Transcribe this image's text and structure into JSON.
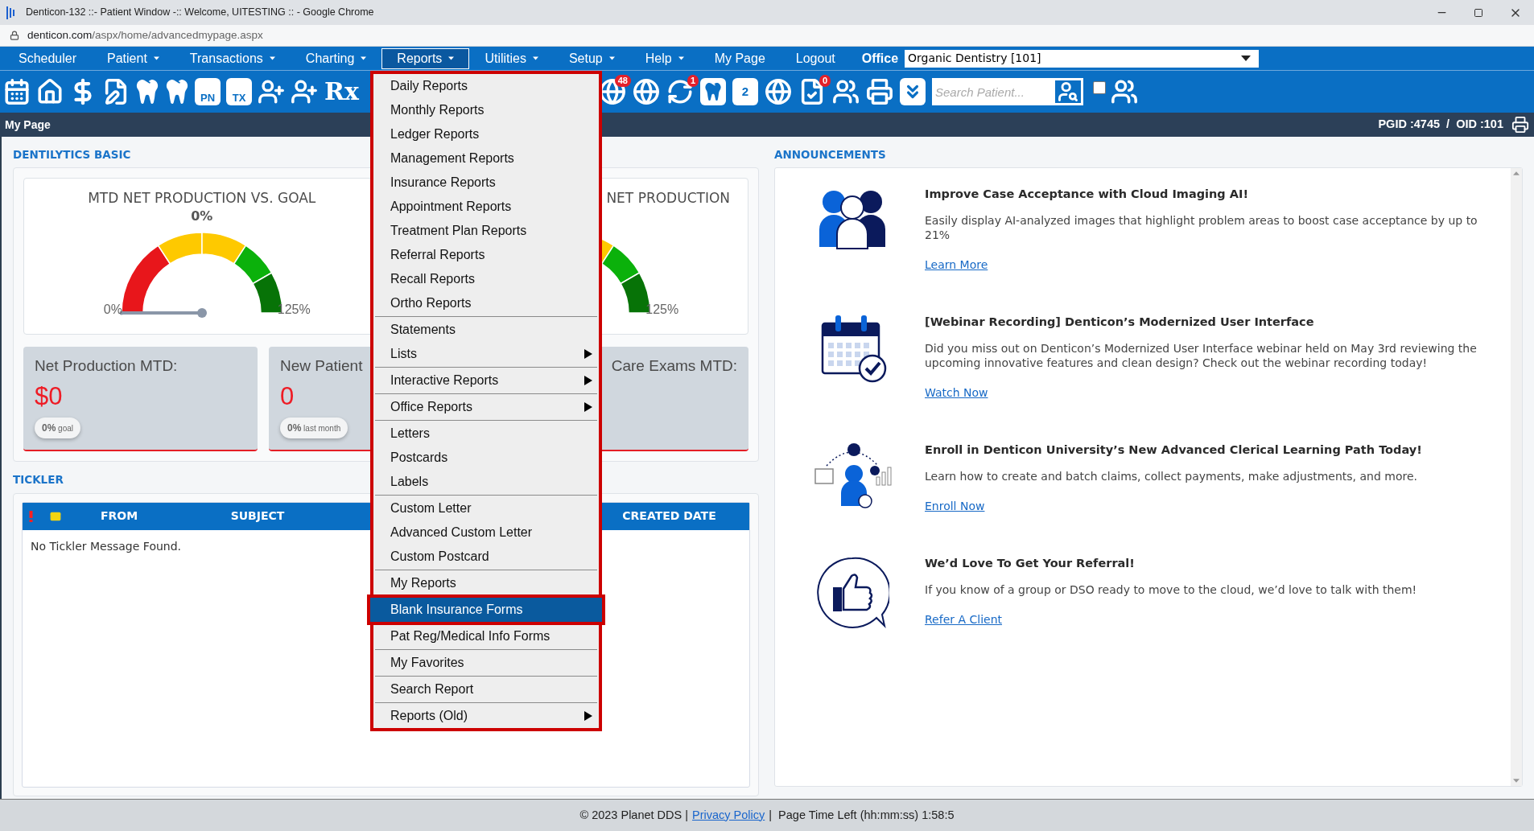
{
  "window": {
    "title": "Denticon-132 ::- Patient Window -:: Welcome, UITESTING :: - Google Chrome"
  },
  "address_bar": {
    "host": "denticon.com",
    "path": "/aspx/home/advancedmypage.aspx"
  },
  "menu_bar": {
    "items": [
      {
        "label": "Scheduler",
        "dropdown": false,
        "selected": false
      },
      {
        "label": "Patient",
        "dropdown": true,
        "selected": false
      },
      {
        "label": "Transactions",
        "dropdown": true,
        "selected": false
      },
      {
        "label": "Charting",
        "dropdown": true,
        "selected": false
      },
      {
        "label": "Reports",
        "dropdown": true,
        "selected": true
      },
      {
        "label": "Utilities",
        "dropdown": true,
        "selected": false
      },
      {
        "label": "Setup",
        "dropdown": true,
        "selected": false
      },
      {
        "label": "Help",
        "dropdown": true,
        "selected": false
      },
      {
        "label": "My Page",
        "dropdown": false,
        "selected": false
      },
      {
        "label": "Logout",
        "dropdown": false,
        "selected": false
      }
    ],
    "office_label": "Office",
    "office_value": "Organic Dentistry [101]"
  },
  "toolbar": {
    "left": [
      {
        "kind": "calendar"
      },
      {
        "kind": "home"
      },
      {
        "kind": "dollar"
      },
      {
        "kind": "edit"
      },
      {
        "kind": "tooth"
      },
      {
        "kind": "tooth"
      },
      {
        "kind": "tile",
        "text": "PN"
      },
      {
        "kind": "tile",
        "text": "TX"
      },
      {
        "kind": "user-add"
      },
      {
        "kind": "user-add"
      },
      {
        "kind": "rx",
        "text": "Rx"
      }
    ],
    "right": [
      {
        "kind": "globe-user",
        "badge": "48"
      },
      {
        "kind": "globe-user"
      },
      {
        "kind": "refresh-user",
        "badge": "1"
      },
      {
        "kind": "tooth-tile"
      },
      {
        "kind": "tooth-tile",
        "text": "2"
      },
      {
        "kind": "globe"
      },
      {
        "kind": "document",
        "badge": "0"
      },
      {
        "kind": "people"
      },
      {
        "kind": "printer"
      },
      {
        "kind": "chevrons"
      }
    ],
    "search": {
      "placeholder": "Search Patient..."
    },
    "checkbox": {
      "checked": false
    }
  },
  "page_bar": {
    "title": "My Page",
    "ids": "PGID :4745  /  OID :101"
  },
  "dentilytics": {
    "heading": "DENTILYTICS BASIC",
    "gauges": [
      {
        "title": "MTD NET PRODUCTION VS. GOAL",
        "center": "0%",
        "min": "0%",
        "max": "125%",
        "level": 0
      },
      {
        "title": "NET PRODUCTION",
        "max": "125%"
      }
    ],
    "cards": [
      {
        "label": "Net Production MTD:",
        "value": "$0",
        "pill": "**0%** goal"
      },
      {
        "label": "New Patient",
        "value": "0",
        "pill": "**0%** last month"
      },
      {
        "label": "Care Exams MTD:"
      }
    ]
  },
  "tickler": {
    "heading": "TICKLER",
    "columns": [
      {
        "kind": "flag"
      },
      {
        "kind": "mail"
      },
      {
        "kind": "text",
        "text": "FROM"
      },
      {
        "kind": "text",
        "text": "SUBJECT"
      },
      {
        "kind": "empty"
      },
      {
        "kind": "text",
        "text": "CREATED DATE"
      }
    ],
    "empty_message": "No Tickler Message Found."
  },
  "announcements": {
    "heading": "ANNOUNCEMENTS",
    "items": [
      {
        "kind": "people",
        "title": "Improve Case Acceptance with Cloud Imaging AI!",
        "body": "Easily display AI-analyzed images that highlight problem areas to boost case acceptance by up to 21%",
        "link": "Learn More"
      },
      {
        "kind": "calendar",
        "title": "[Webinar Recording] Denticon’s Modernized User Interface",
        "body": "Did you miss out on Denticon’s Modernized User Interface webinar held on May 3rd reviewing the upcoming innovative features and clean design? Check out the webinar recording today!",
        "link": "Watch Now"
      },
      {
        "kind": "learner",
        "title": "Enroll in Denticon University’s New Advanced Clerical Learning Path Today!",
        "body": "Learn how to create and batch claims, collect payments, make adjustments, and more.",
        "link": "Enroll Now"
      },
      {
        "kind": "thumbs",
        "title": "We’d Love To Get Your Referral!",
        "body": "If you know of a group or DSO ready to move to the cloud, we’d love to talk with them!",
        "link": "Refer A Client"
      }
    ]
  },
  "reports_menu": {
    "groups": [
      [
        {
          "label": "Daily Reports",
          "submenu": false,
          "selected": false
        },
        {
          "label": "Monthly Reports",
          "submenu": false,
          "selected": false
        },
        {
          "label": "Ledger Reports",
          "submenu": false,
          "selected": false
        },
        {
          "label": "Management Reports",
          "submenu": false,
          "selected": false
        },
        {
          "label": "Insurance Reports",
          "submenu": false,
          "selected": false
        },
        {
          "label": "Appointment Reports",
          "submenu": false,
          "selected": false
        },
        {
          "label": "Treatment Plan Reports",
          "submenu": false,
          "selected": false
        },
        {
          "label": "Referral Reports",
          "submenu": false,
          "selected": false
        },
        {
          "label": "Recall Reports",
          "submenu": false,
          "selected": false
        },
        {
          "label": "Ortho Reports",
          "submenu": false,
          "selected": false
        }
      ],
      [
        {
          "label": "Statements",
          "submenu": false,
          "selected": false
        },
        {
          "label": "Lists",
          "submenu": true,
          "selected": false
        }
      ],
      [
        {
          "label": "Interactive Reports",
          "submenu": true,
          "selected": false
        }
      ],
      [
        {
          "label": "Office Reports",
          "submenu": true,
          "selected": false
        }
      ],
      [
        {
          "label": "Letters",
          "submenu": false,
          "selected": false
        },
        {
          "label": "Postcards",
          "submenu": false,
          "selected": false
        },
        {
          "label": "Labels",
          "submenu": false,
          "selected": false
        }
      ],
      [
        {
          "label": "Custom Letter",
          "submenu": false,
          "selected": false
        },
        {
          "label": "Advanced Custom Letter",
          "submenu": false,
          "selected": false
        },
        {
          "label": "Custom Postcard",
          "submenu": false,
          "selected": false
        }
      ],
      [
        {
          "label": "My Reports",
          "submenu": false,
          "selected": false
        }
      ],
      [
        {
          "label": "Blank Insurance Forms",
          "submenu": false,
          "selected": true
        }
      ],
      [
        {
          "label": "Pat Reg/Medical Info Forms",
          "submenu": false,
          "selected": false
        }
      ],
      [
        {
          "label": "My Favorites",
          "submenu": false,
          "selected": false
        }
      ],
      [
        {
          "label": "Search Report",
          "submenu": false,
          "selected": false
        }
      ],
      [
        {
          "label": "Reports (Old)",
          "submenu": true,
          "selected": false
        }
      ]
    ]
  },
  "footer": {
    "copyright": "© 2023 Planet DDS |",
    "link": "Privacy Policy",
    "time_left": "|  Page Time Left (hh:mm:ss) 1:58:5"
  }
}
